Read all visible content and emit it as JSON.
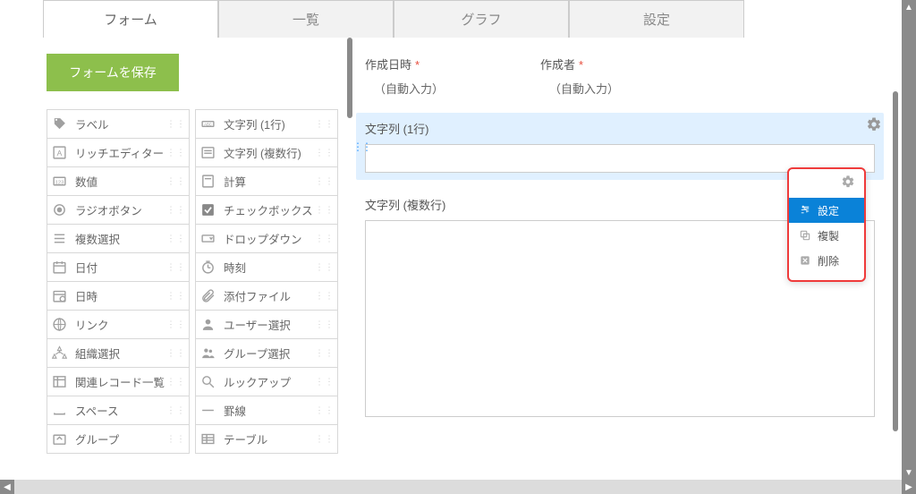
{
  "tabs": [
    {
      "label": "フォーム",
      "active": true
    },
    {
      "label": "一覧",
      "active": false
    },
    {
      "label": "グラフ",
      "active": false
    },
    {
      "label": "設定",
      "active": false
    }
  ],
  "sidebar": {
    "save_label": "フォームを保存",
    "palette_left": [
      {
        "label": "ラベル",
        "icon": "tag"
      },
      {
        "label": "リッチエディター",
        "icon": "richtext"
      },
      {
        "label": "数値",
        "icon": "number"
      },
      {
        "label": "ラジオボタン",
        "icon": "radio"
      },
      {
        "label": "複数選択",
        "icon": "multiselect"
      },
      {
        "label": "日付",
        "icon": "date"
      },
      {
        "label": "日時",
        "icon": "datetime"
      },
      {
        "label": "リンク",
        "icon": "link"
      },
      {
        "label": "組織選択",
        "icon": "org"
      },
      {
        "label": "関連レコード一覧",
        "icon": "related"
      },
      {
        "label": "スペース",
        "icon": "space"
      },
      {
        "label": "グループ",
        "icon": "group"
      }
    ],
    "palette_right": [
      {
        "label": "文字列 (1行)",
        "icon": "text1"
      },
      {
        "label": "文字列 (複数行)",
        "icon": "textmulti"
      },
      {
        "label": "計算",
        "icon": "calc"
      },
      {
        "label": "チェックボックス",
        "icon": "checkbox"
      },
      {
        "label": "ドロップダウン",
        "icon": "dropdown"
      },
      {
        "label": "時刻",
        "icon": "time"
      },
      {
        "label": "添付ファイル",
        "icon": "attach"
      },
      {
        "label": "ユーザー選択",
        "icon": "user"
      },
      {
        "label": "グループ選択",
        "icon": "groupsel"
      },
      {
        "label": "ルックアップ",
        "icon": "lookup"
      },
      {
        "label": "罫線",
        "icon": "line"
      },
      {
        "label": "テーブル",
        "icon": "table"
      }
    ]
  },
  "canvas": {
    "auto_fields": [
      {
        "label": "作成日時",
        "required": true,
        "value": "（自動入力）"
      },
      {
        "label": "作成者",
        "required": true,
        "value": "（自動入力）"
      }
    ],
    "field_text1_label": "文字列 (1行)",
    "field_textmulti_label": "文字列 (複数行)"
  },
  "context_menu": {
    "items": [
      {
        "label": "設定",
        "icon": "settings",
        "active": true
      },
      {
        "label": "複製",
        "icon": "copy",
        "active": false
      },
      {
        "label": "削除",
        "icon": "delete",
        "active": false
      }
    ]
  }
}
